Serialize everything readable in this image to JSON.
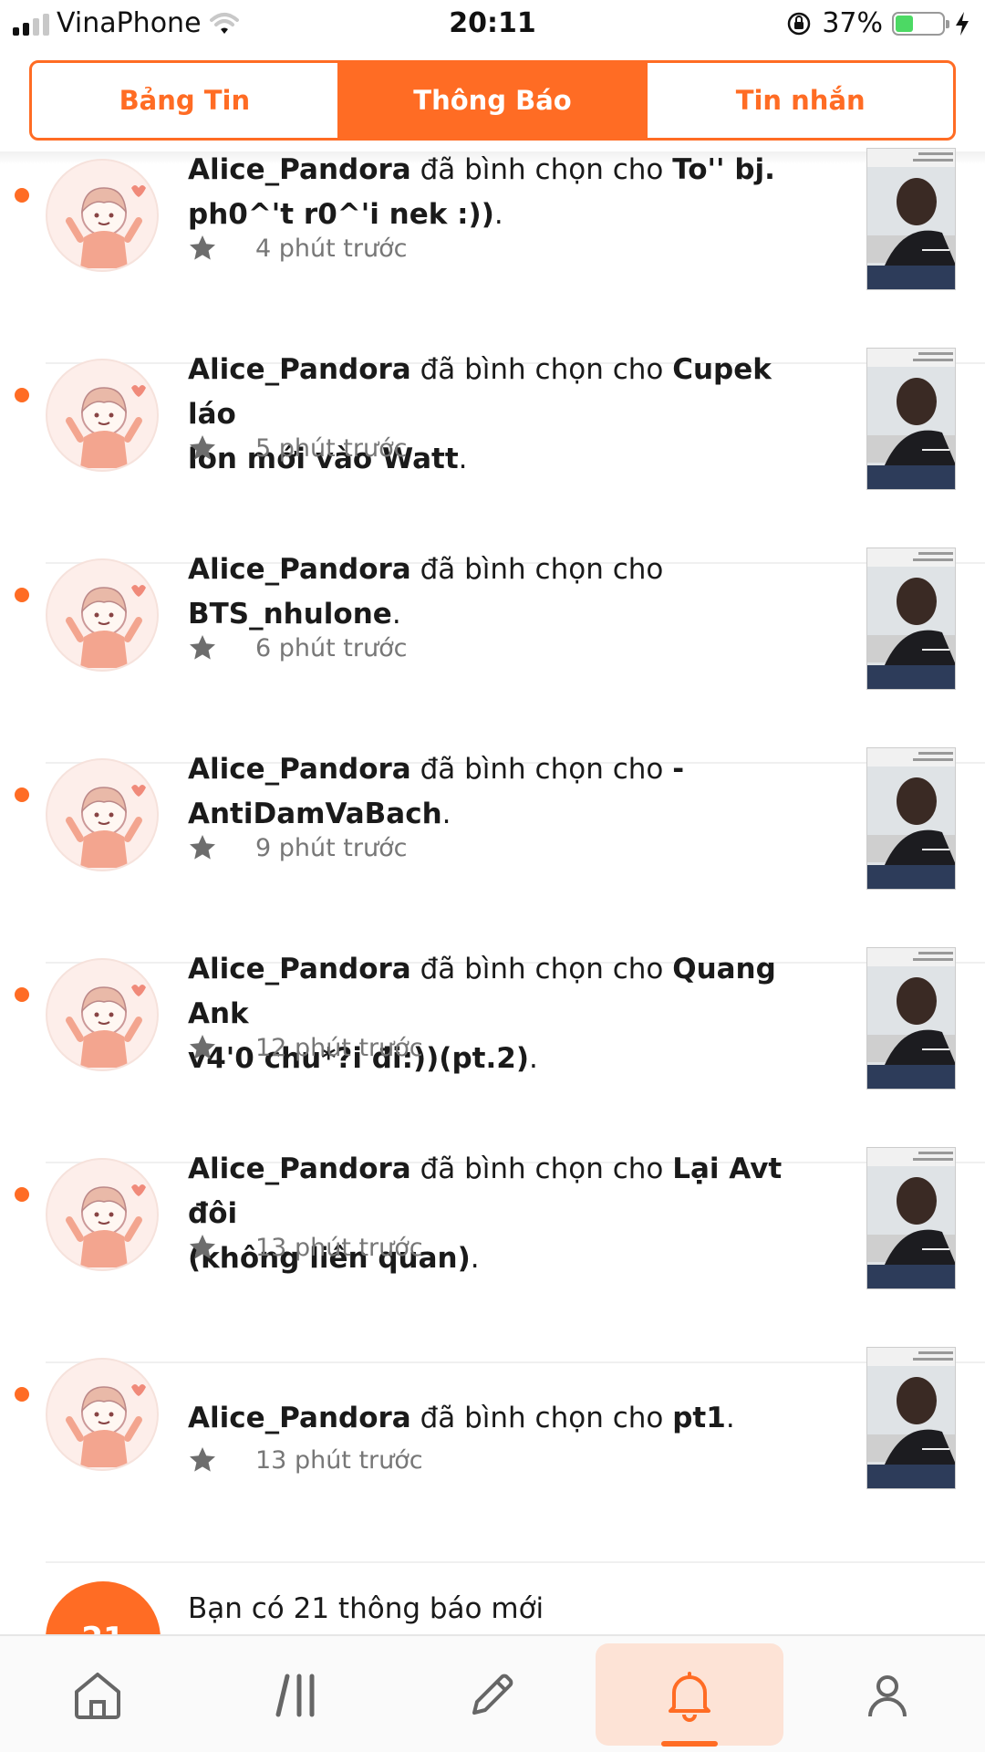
{
  "status_bar": {
    "carrier": "VinaPhone",
    "time": "20:11",
    "battery_percent": "37%",
    "battery_level": 0.37
  },
  "tabs": [
    {
      "label": "Bảng Tin",
      "active": false
    },
    {
      "label": "Thông Báo",
      "active": true
    },
    {
      "label": "Tin nhắn",
      "active": false
    }
  ],
  "notifications": [
    {
      "user": "Alice_Pandora",
      "action": "đã bình chọn cho",
      "target_line1": "To'' bj.",
      "target_line2": "ph0^'t r0^'i nek :))",
      "time": "4 phút trước"
    },
    {
      "user": "Alice_Pandora",
      "action": "đã bình chọn cho",
      "target_line1": "Cupek láo",
      "target_line2": "lòn mới vào Watt",
      "time": "5 phút trước"
    },
    {
      "user": "Alice_Pandora",
      "action": "đã bình chọn cho",
      "target_line1": "",
      "target_line2": "BTS_nhulone",
      "time": "6 phút trước"
    },
    {
      "user": "Alice_Pandora",
      "action": "đã bình chọn cho",
      "target_line1": "-",
      "target_line2": "AntiDamVaBach",
      "time": "9 phút trước"
    },
    {
      "user": "Alice_Pandora",
      "action": "đã bình chọn cho",
      "target_line1": "Quang Ank",
      "target_line2": "v4'0 chu*?i đi:))(pt.2)",
      "time": "12 phút trước"
    },
    {
      "user": "Alice_Pandora",
      "action": "đã bình chọn cho",
      "target_line1": "Lại Avt đôi",
      "target_line2": "(không liên quan)",
      "time": "13 phút trước"
    },
    {
      "user": "Alice_Pandora",
      "action": "đã bình chọn cho",
      "target_line1": "pt1",
      "target_line2": "",
      "time": "13 phút trước"
    }
  ],
  "summary": {
    "count": "21",
    "text": "Bạn có 21 thông báo mới"
  },
  "bottom_nav": [
    {
      "icon": "home-icon",
      "active": false
    },
    {
      "icon": "library-icon",
      "active": false
    },
    {
      "icon": "pencil-icon",
      "active": false
    },
    {
      "icon": "bell-icon",
      "active": true
    },
    {
      "icon": "profile-icon",
      "active": false
    }
  ],
  "colors": {
    "accent": "#ff6c24",
    "unread_dot": "#ff6c24",
    "active_nav_bg": "#fde3d6"
  }
}
